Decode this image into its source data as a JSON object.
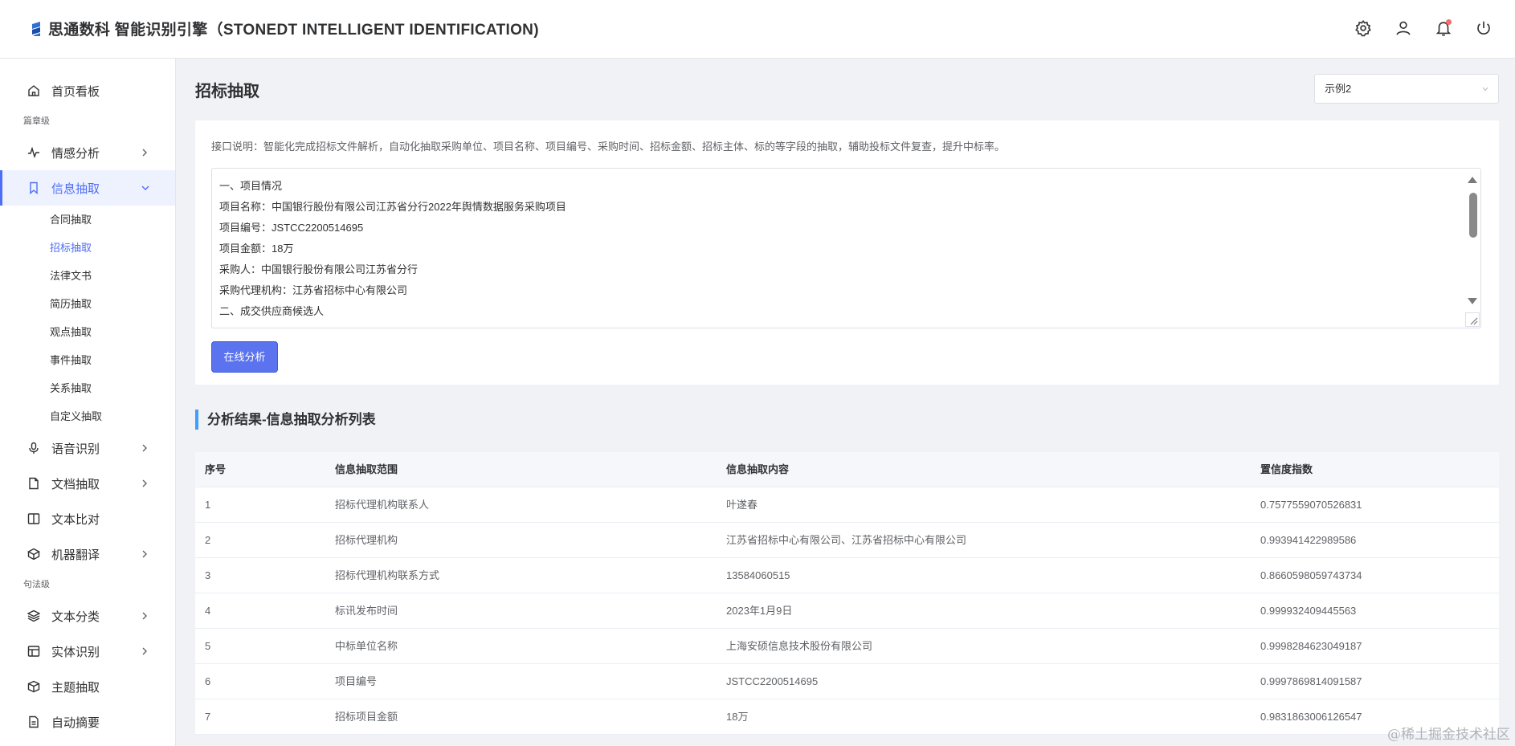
{
  "app": {
    "title": "思通数科 智能识别引擎（STONEDT INTELLIGENT IDENTIFICATION)"
  },
  "header": {
    "icons": [
      "gear-icon",
      "user-icon",
      "bell-icon",
      "power-icon"
    ],
    "has_notification": true
  },
  "sidebar": {
    "home": "首页看板",
    "group_chapter": "篇章级",
    "sentiment": "情感分析",
    "extraction": "信息抽取",
    "sub_items": [
      "合同抽取",
      "招标抽取",
      "法律文书",
      "简历抽取",
      "观点抽取",
      "事件抽取",
      "关系抽取",
      "自定义抽取"
    ],
    "speech": "语音识别",
    "doc_extract": "文档抽取",
    "text_compare": "文本比对",
    "translate": "机器翻译",
    "group_sentence": "句法级",
    "text_classify": "文本分类",
    "entity": "实体识别",
    "topic": "主题抽取",
    "summary": "自动摘要"
  },
  "main": {
    "page_title": "招标抽取",
    "example_select": "示例2",
    "description": "接口说明：智能化完成招标文件解析，自动化抽取采购单位、项目名称、项目编号、采购时间、招标金额、招标主体、标的等字段的抽取，辅助投标文件复查，提升中标率。",
    "input_lines": [
      "一、项目情况",
      "项目名称：中国银行股份有限公司江苏省分行2022年舆情数据服务采购项目",
      "项目编号：JSTCC2200514695",
      "项目金额：18万",
      "采购人：中国银行股份有限公司江苏省分行",
      "采购代理机构：江苏省招标中心有限公司",
      "二、成交供应商候选人"
    ],
    "analyze_button": "在线分析",
    "result_title": "分析结果-信息抽取分析列表"
  },
  "table": {
    "headers": [
      "序号",
      "信息抽取范围",
      "信息抽取内容",
      "置信度指数"
    ],
    "rows": [
      [
        "1",
        "招标代理机构联系人",
        "叶遂春",
        "0.7577559070526831"
      ],
      [
        "2",
        "招标代理机构",
        "江苏省招标中心有限公司、江苏省招标中心有限公司",
        "0.993941422989586"
      ],
      [
        "3",
        "招标代理机构联系方式",
        "13584060515",
        "0.8660598059743734"
      ],
      [
        "4",
        "标讯发布时间",
        "2023年1月9日",
        "0.999932409445563"
      ],
      [
        "5",
        "中标单位名称",
        "上海安硕信息技术股份有限公司",
        "0.9998284623049187"
      ],
      [
        "6",
        "项目编号",
        "JSTCC2200514695",
        "0.9997869814091587"
      ],
      [
        "7",
        "招标项目金额",
        "18万",
        "0.9831863006126547"
      ]
    ]
  },
  "watermark": "@稀土掘金技术社区",
  "colors": {
    "accent": "#4f6ef7",
    "button": "#5b73ee",
    "result_bar": "#409eff"
  }
}
